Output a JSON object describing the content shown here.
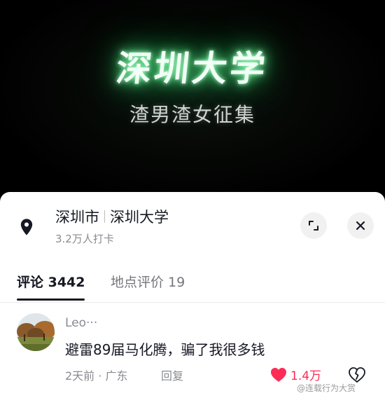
{
  "video": {
    "title": "深圳大学",
    "subtitle": "渣男渣女征集"
  },
  "location": {
    "city": "深圳市",
    "place": "深圳大学",
    "checkins": "3.2万人打卡",
    "icon": "location-pin-icon"
  },
  "controls": {
    "expand_icon": "expand-icon",
    "close_icon": "close-icon"
  },
  "tabs": [
    {
      "label": "评论 3442",
      "active": true
    },
    {
      "label": "地点评价 19",
      "active": false
    }
  ],
  "comment": {
    "username": "Leo···",
    "text": "避雷89届马化腾，骗了我很多钱",
    "meta": "2天前 · 广东",
    "reply_label": "回复",
    "likes": "1.4万",
    "liked": true,
    "like_color": "#fe2c55"
  },
  "watermark": "@连载行为大赏"
}
